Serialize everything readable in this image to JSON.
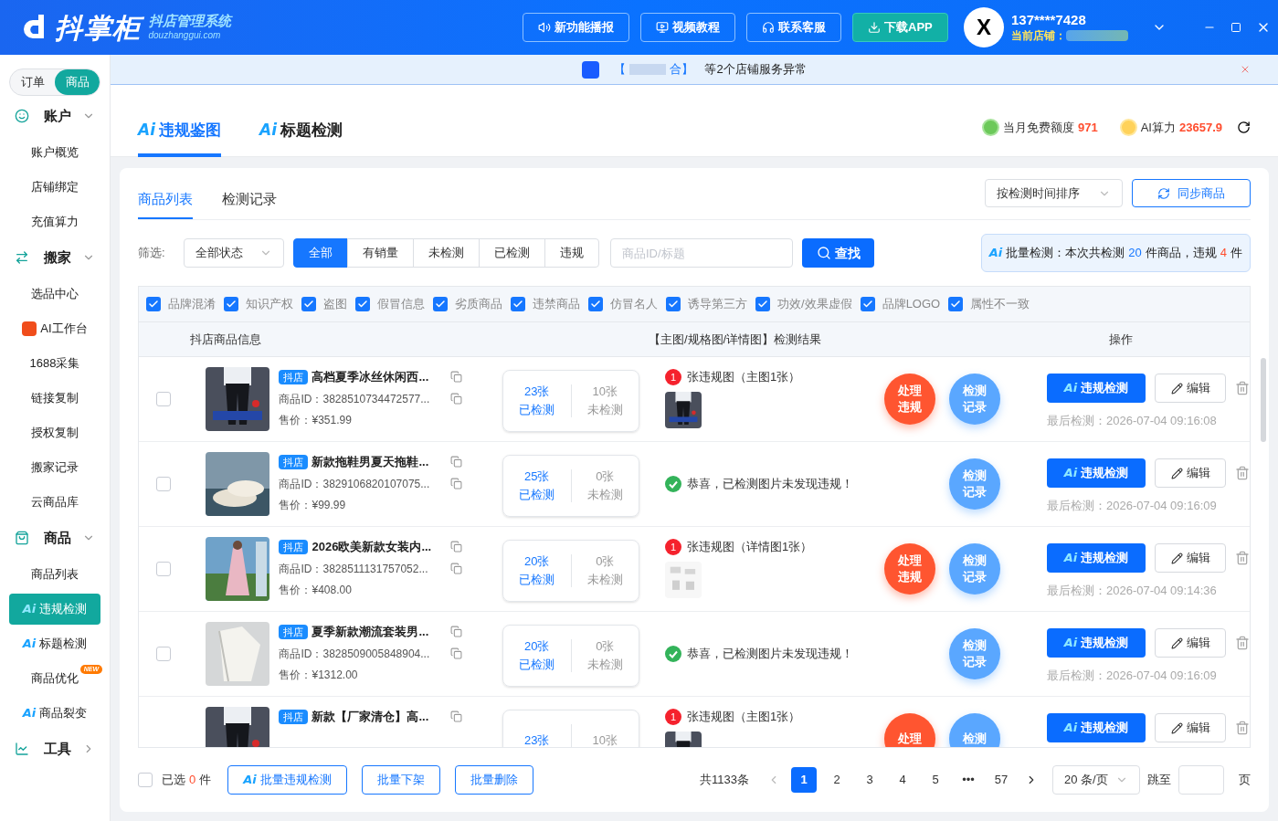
{
  "header": {
    "brand": "抖掌柜",
    "brand_sub": "抖店管理系统",
    "brand_url": "douzhanggui.com",
    "buttons": [
      {
        "label": "新功能播报",
        "kind": "speaker"
      },
      {
        "label": "视频教程",
        "kind": "video"
      },
      {
        "label": "联系客服",
        "kind": "headset"
      },
      {
        "label": "下载APP",
        "kind": "download"
      }
    ],
    "avatar": "X",
    "phone": "137****7428",
    "store_label": "当前店铺："
  },
  "sidebar": {
    "switch": [
      {
        "label": "订单",
        "selected": false
      },
      {
        "label": "商品",
        "selected": true
      }
    ],
    "groups": [
      {
        "label": "账户",
        "expanded": true,
        "children": [
          {
            "label": "账户概览",
            "selected": false
          },
          {
            "label": "店铺绑定",
            "selected": false
          },
          {
            "label": "充值算力",
            "selected": false
          }
        ]
      },
      {
        "label": "搬家",
        "expanded": true,
        "children": [
          {
            "label": "选品中心",
            "selected": false
          },
          {
            "label": "AI工作台",
            "selected": false
          },
          {
            "label": "1688采集",
            "selected": false
          },
          {
            "label": "链接复制",
            "selected": false
          },
          {
            "label": "授权复制",
            "selected": false
          },
          {
            "label": "搬家记录",
            "selected": false
          },
          {
            "label": "云商品库",
            "selected": false
          }
        ]
      },
      {
        "label": "商品",
        "expanded": true,
        "children": [
          {
            "label": "商品列表",
            "selected": false
          },
          {
            "label": "违规检测",
            "ai": "Ai",
            "selected": true
          },
          {
            "label": "标题检测",
            "ai": "Ai",
            "selected": false
          },
          {
            "label": "商品优化",
            "badge": "NEW",
            "selected": false
          },
          {
            "label": "商品裂变",
            "ai": "Ai",
            "selected": false
          }
        ]
      },
      {
        "label": "工具",
        "expanded": false
      }
    ]
  },
  "notice": {
    "open": "【",
    "close": "合】",
    "text": "等2个店铺服务异常"
  },
  "top_tabs": [
    {
      "ai": "Ai",
      "label": "违规鉴图",
      "selected": true
    },
    {
      "ai": "Ai",
      "label": "标题检测",
      "selected": false
    }
  ],
  "quota": {
    "free_label": "当月免费额度",
    "free_value": "971",
    "power_label": "AI算力",
    "power_value": "23657.9"
  },
  "sub_tabs": [
    {
      "label": "商品列表",
      "selected": true
    },
    {
      "label": "检测记录",
      "selected": false
    }
  ],
  "sort_select": "按检测时间排序",
  "sync_button": "同步商品",
  "filter": {
    "label": "筛选:",
    "status_select": "全部状态",
    "segments": [
      {
        "label": "全部",
        "selected": true
      },
      {
        "label": "有销量",
        "selected": false
      },
      {
        "label": "未检测",
        "selected": false
      },
      {
        "label": "已检测",
        "selected": false
      },
      {
        "label": "违规",
        "selected": false
      }
    ],
    "search_placeholder": "商品ID/标题",
    "search_button": "查找"
  },
  "batch_summary": {
    "ai": "Ai",
    "prefix": "批量检测：本次共检测",
    "total": "20",
    "middle": "件商品，违规",
    "violations": "4",
    "suffix": "件"
  },
  "categories": [
    {
      "label": "品牌混淆",
      "checked": true
    },
    {
      "label": "知识产权",
      "checked": true
    },
    {
      "label": "盗图",
      "checked": true
    },
    {
      "label": "假冒信息",
      "checked": true
    },
    {
      "label": "劣质商品",
      "checked": true
    },
    {
      "label": "违禁商品",
      "checked": true
    },
    {
      "label": "仿冒名人",
      "checked": true
    },
    {
      "label": "诱导第三方",
      "checked": true
    },
    {
      "label": "功效/效果虚假",
      "checked": true
    },
    {
      "label": "品牌LOGO",
      "checked": true
    },
    {
      "label": "属性不一致",
      "checked": true
    }
  ],
  "table": {
    "columns": [
      "抖店商品信息",
      "【主图/规格图/详情图】检测结果",
      "操作"
    ],
    "rows": [
      {
        "checked": false,
        "tag": "抖店",
        "title": "高档夏季冰丝休闲西...",
        "id": "商品ID：3828510734472577...",
        "price": "售价：¥351.99",
        "detected": "23张",
        "detected_label": "已检测",
        "undetected": "10张",
        "undetected_label": "未检测",
        "result": {
          "kind": "violation",
          "count": "1",
          "text": "张违规图（主图1张）"
        },
        "handle": "处理违规",
        "record": "检测记录",
        "check_ai": "Ai",
        "check": "违规检测",
        "edit": "编辑",
        "last": "最后检测：2026-07-04 09:16:08"
      },
      {
        "checked": false,
        "tag": "抖店",
        "title": "新款拖鞋男夏天拖鞋...",
        "id": "商品ID：3829106820107075...",
        "price": "售价：¥99.99",
        "detected": "25张",
        "detected_label": "已检测",
        "undetected": "0张",
        "undetected_label": "未检测",
        "result": {
          "kind": "ok",
          "text": "恭喜，已检测图片未发现违规！"
        },
        "record": "检测记录",
        "check_ai": "Ai",
        "check": "违规检测",
        "edit": "编辑",
        "last": "最后检测：2026-07-04 09:16:09"
      },
      {
        "checked": false,
        "tag": "抖店",
        "title": "2026欧美新款女装内...",
        "id": "商品ID：3828511131757052...",
        "price": "售价：¥408.00",
        "detected": "20张",
        "detected_label": "已检测",
        "undetected": "0张",
        "undetected_label": "未检测",
        "result": {
          "kind": "violation",
          "count": "1",
          "text": "张违规图（详情图1张）"
        },
        "handle": "处理违规",
        "record": "检测记录",
        "check_ai": "Ai",
        "check": "违规检测",
        "edit": "编辑",
        "last": "最后检测：2026-07-04 09:14:36"
      },
      {
        "checked": false,
        "tag": "抖店",
        "title": "夏季新款潮流套装男...",
        "id": "商品ID：3828509005848904...",
        "price": "售价：¥1312.00",
        "detected": "20张",
        "detected_label": "已检测",
        "undetected": "0张",
        "undetected_label": "未检测",
        "result": {
          "kind": "ok",
          "text": "恭喜，已检测图片未发现违规！"
        },
        "record": "检测记录",
        "check_ai": "Ai",
        "check": "违规检测",
        "edit": "编辑",
        "last": "最后检测：2026-07-04 09:16:09"
      },
      {
        "tag": "抖店",
        "title": "新款【厂家清仓】高...",
        "detected": "23张",
        "undetected": "10张",
        "result": {
          "kind": "violation",
          "count": "1",
          "text": "张违规图（主图1张）"
        },
        "handle": "处理",
        "record": "检测",
        "check_ai": "Ai",
        "check": "违规检测",
        "edit": "编辑"
      }
    ]
  },
  "footer": {
    "select_all": {
      "checked": false
    },
    "selected_label": "已选",
    "selected_count": "0",
    "selected_unit": "件",
    "batch_buttons": [
      {
        "ai": "Ai",
        "label": "批量违规检测"
      },
      {
        "label": "批量下架"
      },
      {
        "label": "批量删除"
      }
    ],
    "total": "共1133条",
    "pages": [
      {
        "label": "1",
        "selected": true
      },
      {
        "label": "2",
        "selected": false
      },
      {
        "label": "3",
        "selected": false
      },
      {
        "label": "4",
        "selected": false
      },
      {
        "label": "5",
        "selected": false
      },
      {
        "label": "•••",
        "selected": false
      },
      {
        "label": "57",
        "selected": false
      }
    ],
    "page_size": "20 条/页",
    "jump_label": "跳至",
    "page_unit": "页"
  }
}
